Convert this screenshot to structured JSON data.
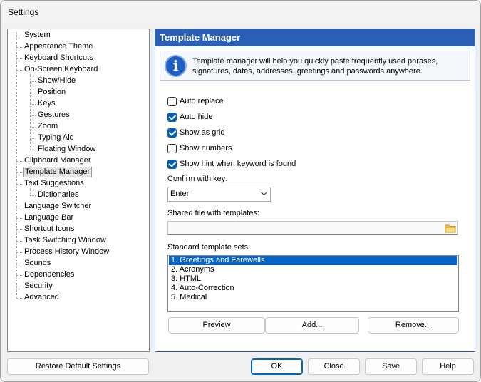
{
  "window": {
    "title": "Settings"
  },
  "tree": {
    "items": [
      {
        "label": "System",
        "level": 0
      },
      {
        "label": "Appearance Theme",
        "level": 0
      },
      {
        "label": "Keyboard Shortcuts",
        "level": 0
      },
      {
        "label": "On-Screen Keyboard",
        "level": 0
      },
      {
        "label": "Show/Hide",
        "level": 1
      },
      {
        "label": "Position",
        "level": 1
      },
      {
        "label": "Keys",
        "level": 1
      },
      {
        "label": "Gestures",
        "level": 1
      },
      {
        "label": "Zoom",
        "level": 1
      },
      {
        "label": "Typing Aid",
        "level": 1
      },
      {
        "label": "Floating Window",
        "level": 1
      },
      {
        "label": "Clipboard Manager",
        "level": 0
      },
      {
        "label": "Template Manager",
        "level": 0,
        "selected": true
      },
      {
        "label": "Text Suggestions",
        "level": 0
      },
      {
        "label": "Dictionaries",
        "level": 1
      },
      {
        "label": "Language Switcher",
        "level": 0
      },
      {
        "label": "Language Bar",
        "level": 0
      },
      {
        "label": "Shortcut Icons",
        "level": 0
      },
      {
        "label": "Task Switching Window",
        "level": 0
      },
      {
        "label": "Process History Window",
        "level": 0
      },
      {
        "label": "Sounds",
        "level": 0
      },
      {
        "label": "Dependencies",
        "level": 0
      },
      {
        "label": "Security",
        "level": 0
      },
      {
        "label": "Advanced",
        "level": 0
      }
    ]
  },
  "panel": {
    "header": "Template Manager",
    "info_icon": "info-icon",
    "info_line1": "Template manager will help you quickly paste frequently used phrases,",
    "info_line2": "signatures, dates, addresses, greetings and passwords anywhere.",
    "checkboxes": [
      {
        "label": "Auto replace",
        "checked": false
      },
      {
        "label": "Auto hide",
        "checked": true
      },
      {
        "label": "Show as grid",
        "checked": true
      },
      {
        "label": "Show numbers",
        "checked": false
      },
      {
        "label": "Show hint when keyword is found",
        "checked": true
      }
    ],
    "confirm_label": "Confirm with key:",
    "confirm_value": "Enter",
    "shared_file_label": "Shared file with templates:",
    "shared_file_value": "",
    "sets_label": "Standard template sets:",
    "sets": [
      {
        "label": "1. Greetings and Farewells",
        "selected": true
      },
      {
        "label": "2. Acronyms"
      },
      {
        "label": "3. HTML"
      },
      {
        "label": "4. Auto-Correction"
      },
      {
        "label": "5. Medical"
      }
    ],
    "buttons": {
      "preview": "Preview",
      "add": "Add...",
      "remove": "Remove..."
    }
  },
  "footer": {
    "restore": "Restore Default Settings",
    "ok": "OK",
    "close": "Close",
    "save": "Save",
    "help": "Help"
  },
  "colors": {
    "header_bg": "#2b5fb5",
    "selection": "#0a64c8",
    "checkbox_on": "#005fb8"
  }
}
